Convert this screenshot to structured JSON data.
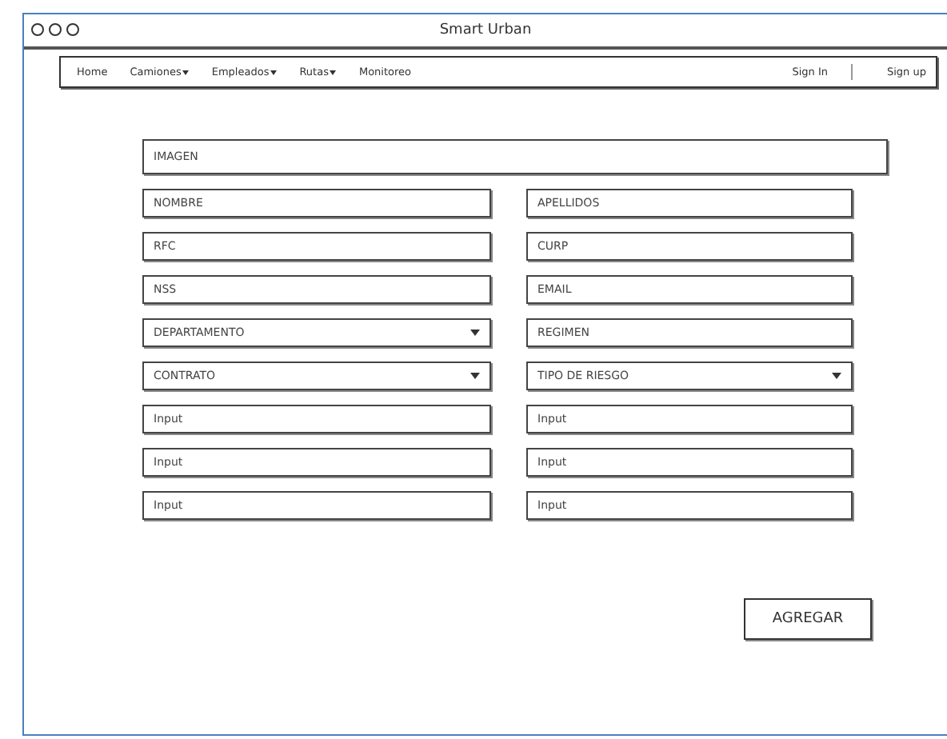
{
  "window": {
    "title": "Smart Urban"
  },
  "nav": {
    "items": [
      {
        "label": "Home",
        "dropdown": false
      },
      {
        "label": "Camiones",
        "dropdown": true
      },
      {
        "label": "Empleados",
        "dropdown": true
      },
      {
        "label": "Rutas",
        "dropdown": true
      },
      {
        "label": "Monitoreo",
        "dropdown": false
      }
    ],
    "auth": [
      "Sign In",
      "Sign up"
    ]
  },
  "form": {
    "image_field": {
      "kind": "text",
      "placeholder": "IMAGEN"
    },
    "rows": [
      [
        {
          "kind": "text",
          "placeholder": "NOMBRE"
        },
        {
          "kind": "text",
          "placeholder": "APELLIDOS"
        }
      ],
      [
        {
          "kind": "text",
          "placeholder": "RFC"
        },
        {
          "kind": "text",
          "placeholder": "CURP"
        }
      ],
      [
        {
          "kind": "text",
          "placeholder": "NSS"
        },
        {
          "kind": "text",
          "placeholder": "EMAIL"
        }
      ],
      [
        {
          "kind": "select",
          "placeholder": "DEPARTAMENTO"
        },
        {
          "kind": "text",
          "placeholder": "REGIMEN"
        }
      ],
      [
        {
          "kind": "select",
          "placeholder": "CONTRATO"
        },
        {
          "kind": "select",
          "placeholder": "TIPO DE RIESGO"
        }
      ],
      [
        {
          "kind": "text",
          "placeholder": "Input"
        },
        {
          "kind": "text",
          "placeholder": "Input"
        }
      ],
      [
        {
          "kind": "text",
          "placeholder": "Input"
        },
        {
          "kind": "text",
          "placeholder": "Input"
        }
      ],
      [
        {
          "kind": "text",
          "placeholder": "Input"
        },
        {
          "kind": "text",
          "placeholder": "Input"
        }
      ]
    ],
    "submit": "AGREGAR"
  }
}
